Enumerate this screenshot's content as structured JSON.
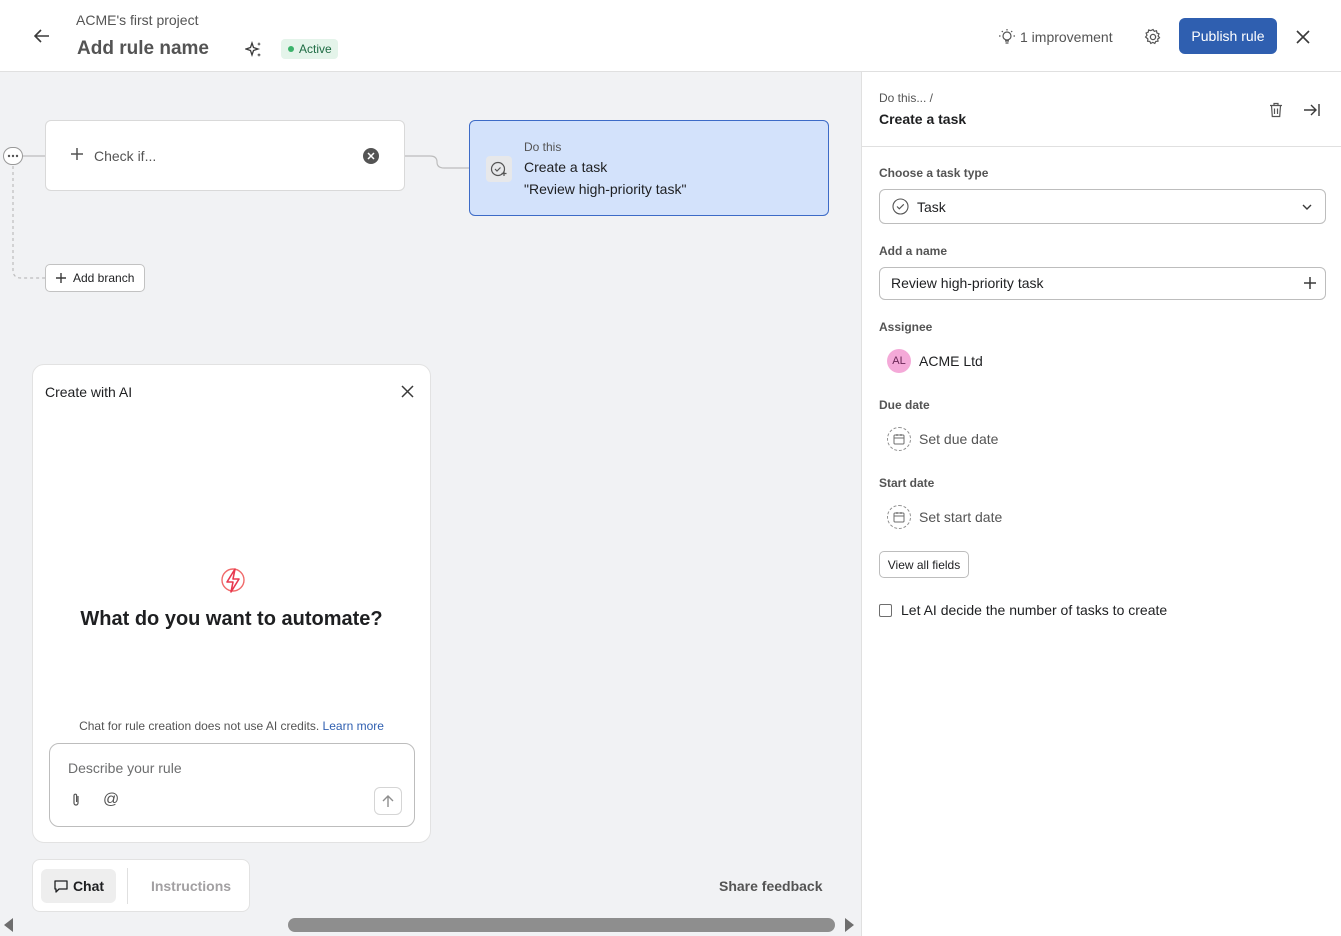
{
  "header": {
    "project_name": "ACME's first project",
    "rule_name_placeholder": "Add rule name",
    "status": "Active",
    "improvement": "1 improvement",
    "publish_label": "Publish rule"
  },
  "canvas": {
    "check_if_label": "Check if...",
    "do_this": {
      "small": "Do this",
      "title": "Create a task",
      "subtitle": "\"Review high-priority task\""
    },
    "add_branch_label": "Add branch"
  },
  "ai_panel": {
    "title": "Create with AI",
    "question": "What do you want to automate?",
    "note": "Chat for rule creation does not use AI credits.",
    "learn_more": "Learn more",
    "input_placeholder": "Describe your rule"
  },
  "tabs": {
    "chat": "Chat",
    "instructions": "Instructions"
  },
  "share_feedback": "Share feedback",
  "side": {
    "breadcrumb": "Do this...  /",
    "title": "Create a task",
    "task_type_label": "Choose a task type",
    "task_type_value": "Task",
    "name_label": "Add a name",
    "name_value": "Review high-priority task",
    "assignee_label": "Assignee",
    "assignee_initials": "AL",
    "assignee_name": "ACME Ltd",
    "due_label": "Due date",
    "due_placeholder": "Set due date",
    "start_label": "Start date",
    "start_placeholder": "Set start date",
    "view_all": "View all fields",
    "ai_decide": "Let AI decide the number of tasks to create"
  },
  "colors": {
    "accent": "#2f5fb0",
    "status_green": "#3bb36b",
    "selected_card": "#d3e2fb"
  }
}
